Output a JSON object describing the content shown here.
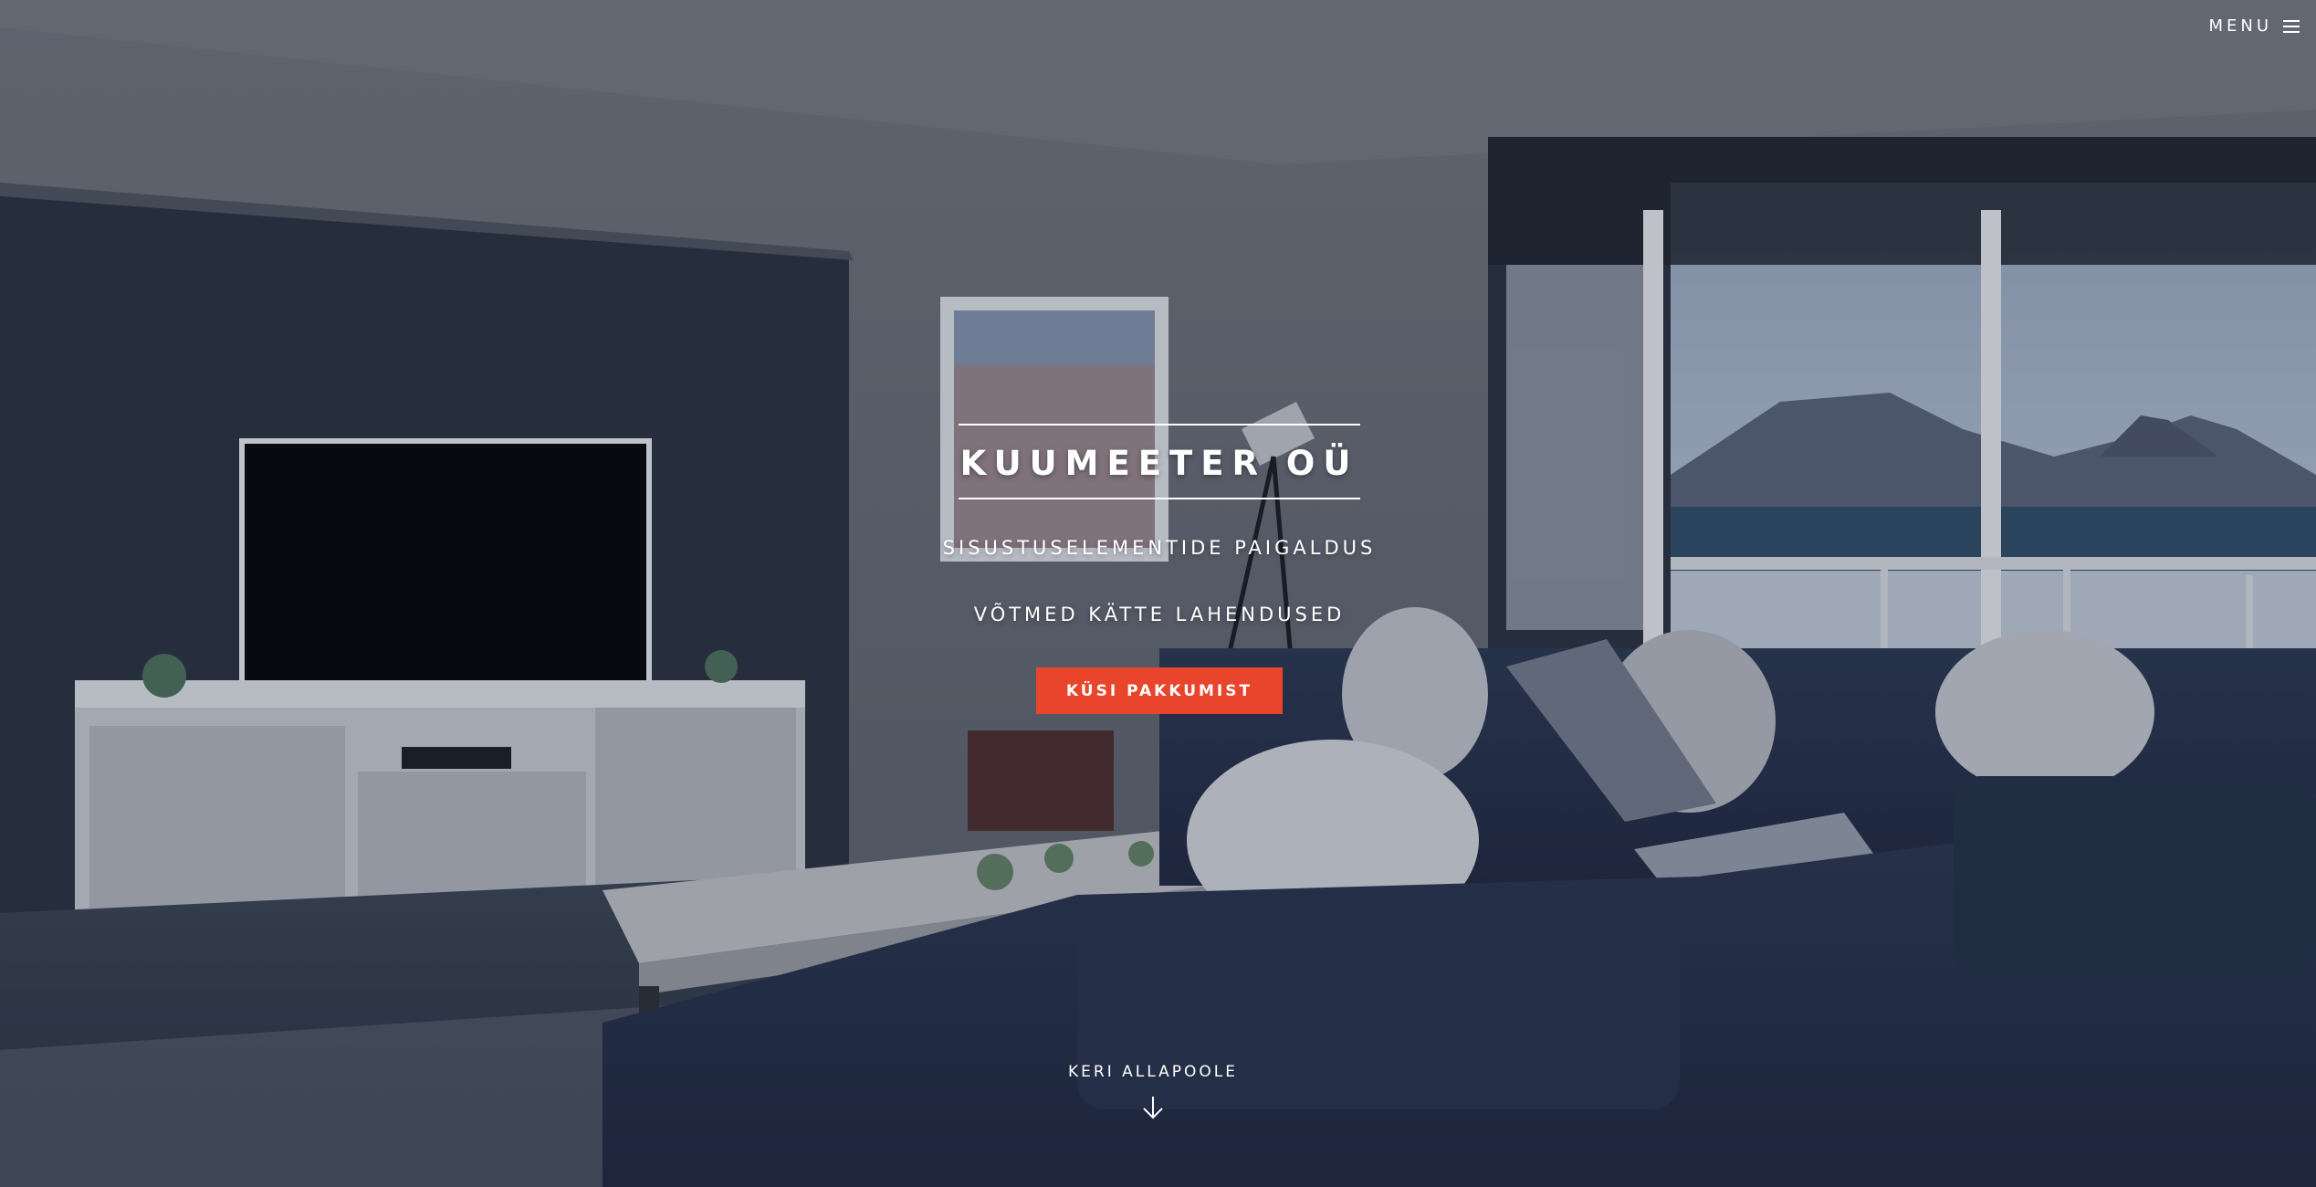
{
  "nav": {
    "menu_label": "MENU"
  },
  "hero": {
    "title": "KUUMEETER OÜ",
    "subtitle_1": "SISUSTUSELEMENTIDE PAIGALDUS",
    "subtitle_2": "VÕTMED KÄTTE LAHENDUSED",
    "cta_label": "KÜSI PAKKUMIST",
    "scroll_label": "KERI ALLAPOOLE"
  },
  "colors": {
    "accent": "#e8452c",
    "text": "#ffffff"
  },
  "icons": {
    "menu": "hamburger-icon",
    "scroll": "arrow-down-icon"
  }
}
